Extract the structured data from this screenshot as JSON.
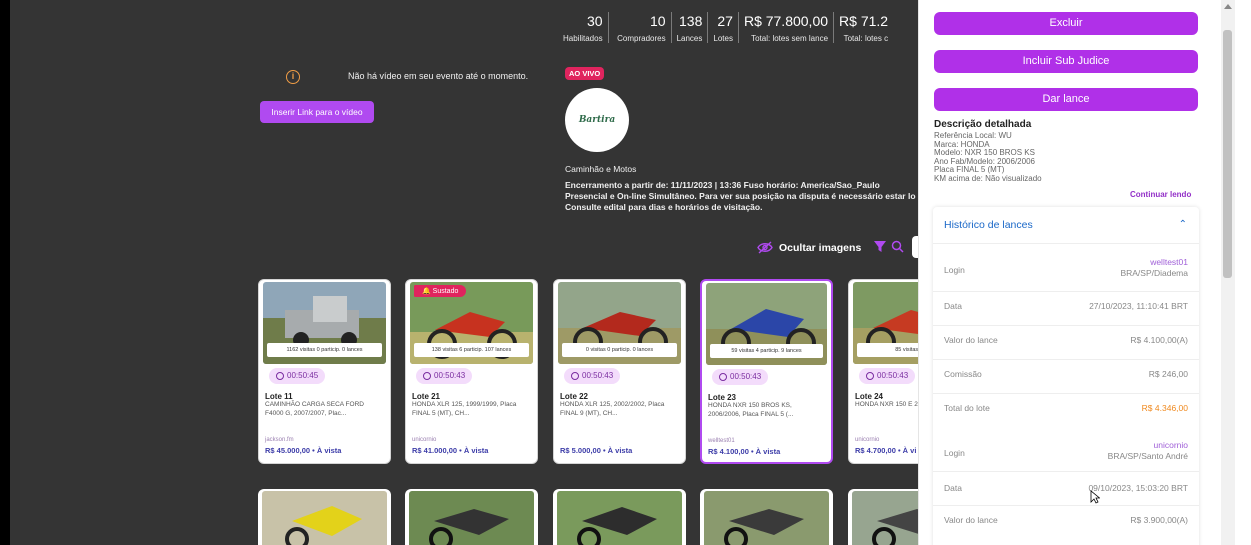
{
  "video": {
    "message": "Não há vídeo em seu evento até o momento.",
    "button_label": "Inserir Link para o vídeo"
  },
  "stats": [
    {
      "value": "30",
      "label": "Habilitados"
    },
    {
      "value": "10",
      "label": "Compradores"
    },
    {
      "value": "138",
      "label": "Lances"
    },
    {
      "value": "27",
      "label": "Lotes"
    },
    {
      "value": "R$ 77.800,00",
      "label": "Total: lotes sem lance"
    },
    {
      "value": "R$ 71.2",
      "label": "Total: lotes c"
    }
  ],
  "event": {
    "live_badge": "AO VIVO",
    "logo_text": "Bartira",
    "category": "Caminhão e Motos",
    "info_line1": "Encerramento a partir de: 11/11/2023 | 13:36 Fuso horário: America/Sao_Paulo",
    "info_line2": "Presencial e On-line Simultâneo. Para ver sua posição na disputa é necessário estar lo",
    "info_line3": "Consulte edital para dias e horários de visitação."
  },
  "toolbar": {
    "hide_images": "Ocultar imagens"
  },
  "lots": [
    {
      "views": "1162 visitas 0 particip. 0 lances",
      "timer": "00:50:45",
      "title": "Lote 11",
      "desc": "CAMINHÃO CARGA SECA FORD F4000 G, 2007/2007, Plac...",
      "user": "jackson.fm",
      "price": "R$ 45.000,00 • À vista"
    },
    {
      "badge": "Sustado",
      "views": "138 visitas 6 particip. 107 lances",
      "timer": "00:50:43",
      "title": "Lote 21",
      "desc": "HONDA XLR 125, 1999/1999, Placa FINAL 5 (MT), CH...",
      "user": "unicornio",
      "price": "R$ 41.000,00 • À vista"
    },
    {
      "views": "0 visitas 0 particip. 0 lances",
      "timer": "00:50:43",
      "title": "Lote 22",
      "desc": "HONDA XLR 125, 2002/2002, Placa FINAL 9 (MT), CH...",
      "user": "",
      "price": "R$ 5.000,00 • À vista"
    },
    {
      "views": "59 visitas 4 particip. 9 lances",
      "timer": "00:50:43",
      "title": "Lote 23",
      "desc": "HONDA NXR 150 BROS KS, 2006/2006, Placa FINAL 5 (...",
      "user": "welltest01",
      "price": "R$ 4.100,00 • À vista"
    },
    {
      "views": "85 visitas 3 part",
      "timer": "00:50:43",
      "title": "Lote 24",
      "desc": "HONDA NXR 150 E 2006/2007, Placa",
      "user": "unicornio",
      "price": "R$ 4.700,00 • À vi"
    }
  ],
  "panel": {
    "excluir": "Excluir",
    "sub_judice": "Incluir Sub Judice",
    "dar_lance": "Dar lance",
    "desc_title": "Descrição detalhada",
    "desc_lines": [
      "Referência Local: WU",
      "Marca: HONDA",
      "Modelo: NXR 150 BROS KS",
      "Ano Fab/Modelo: 2006/2006",
      "Placa FINAL 5 (MT)",
      "KM acima de: Não visualizado"
    ],
    "continue": "Continuar lendo",
    "history_title": "Histórico de lances",
    "bid1": {
      "login_label": "Login",
      "login_user": "welltest01",
      "login_loc": "BRA/SP/Diadema",
      "data_label": "Data",
      "data_value": "27/10/2023, 11:10:41 BRT",
      "valor_label": "Valor do lance",
      "valor_value": "R$ 4.100,00(A)",
      "comissao_label": "Comissão",
      "comissao_value": "R$ 246,00",
      "total_label": "Total do lote",
      "total_value": "R$ 4.346,00"
    },
    "bid2": {
      "login_label": "Login",
      "login_user": "unicornio",
      "login_loc": "BRA/SP/Santo André",
      "data_label": "Data",
      "data_value": "09/10/2023, 15:03:20 BRT",
      "valor_label": "Valor do lance",
      "valor_value": "R$ 3.900,00(A)"
    }
  }
}
